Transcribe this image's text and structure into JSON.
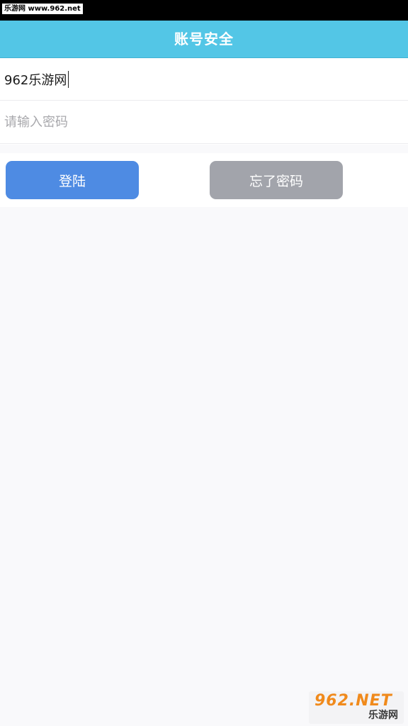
{
  "watermark": {
    "top_text": "乐游网 www.962.net"
  },
  "header": {
    "title": "账号安全"
  },
  "form": {
    "username_value": "962乐游网",
    "password_placeholder": "请输入密码"
  },
  "buttons": {
    "login_label": "登陆",
    "forgot_label": "忘了密码"
  },
  "logo": {
    "main": "962.NET",
    "sub": "乐游网"
  },
  "colors": {
    "header": "#53c6e6",
    "login_button": "#4e8be3",
    "forgot_button": "#a2a4ab",
    "page_background": "#f9f9fb"
  }
}
